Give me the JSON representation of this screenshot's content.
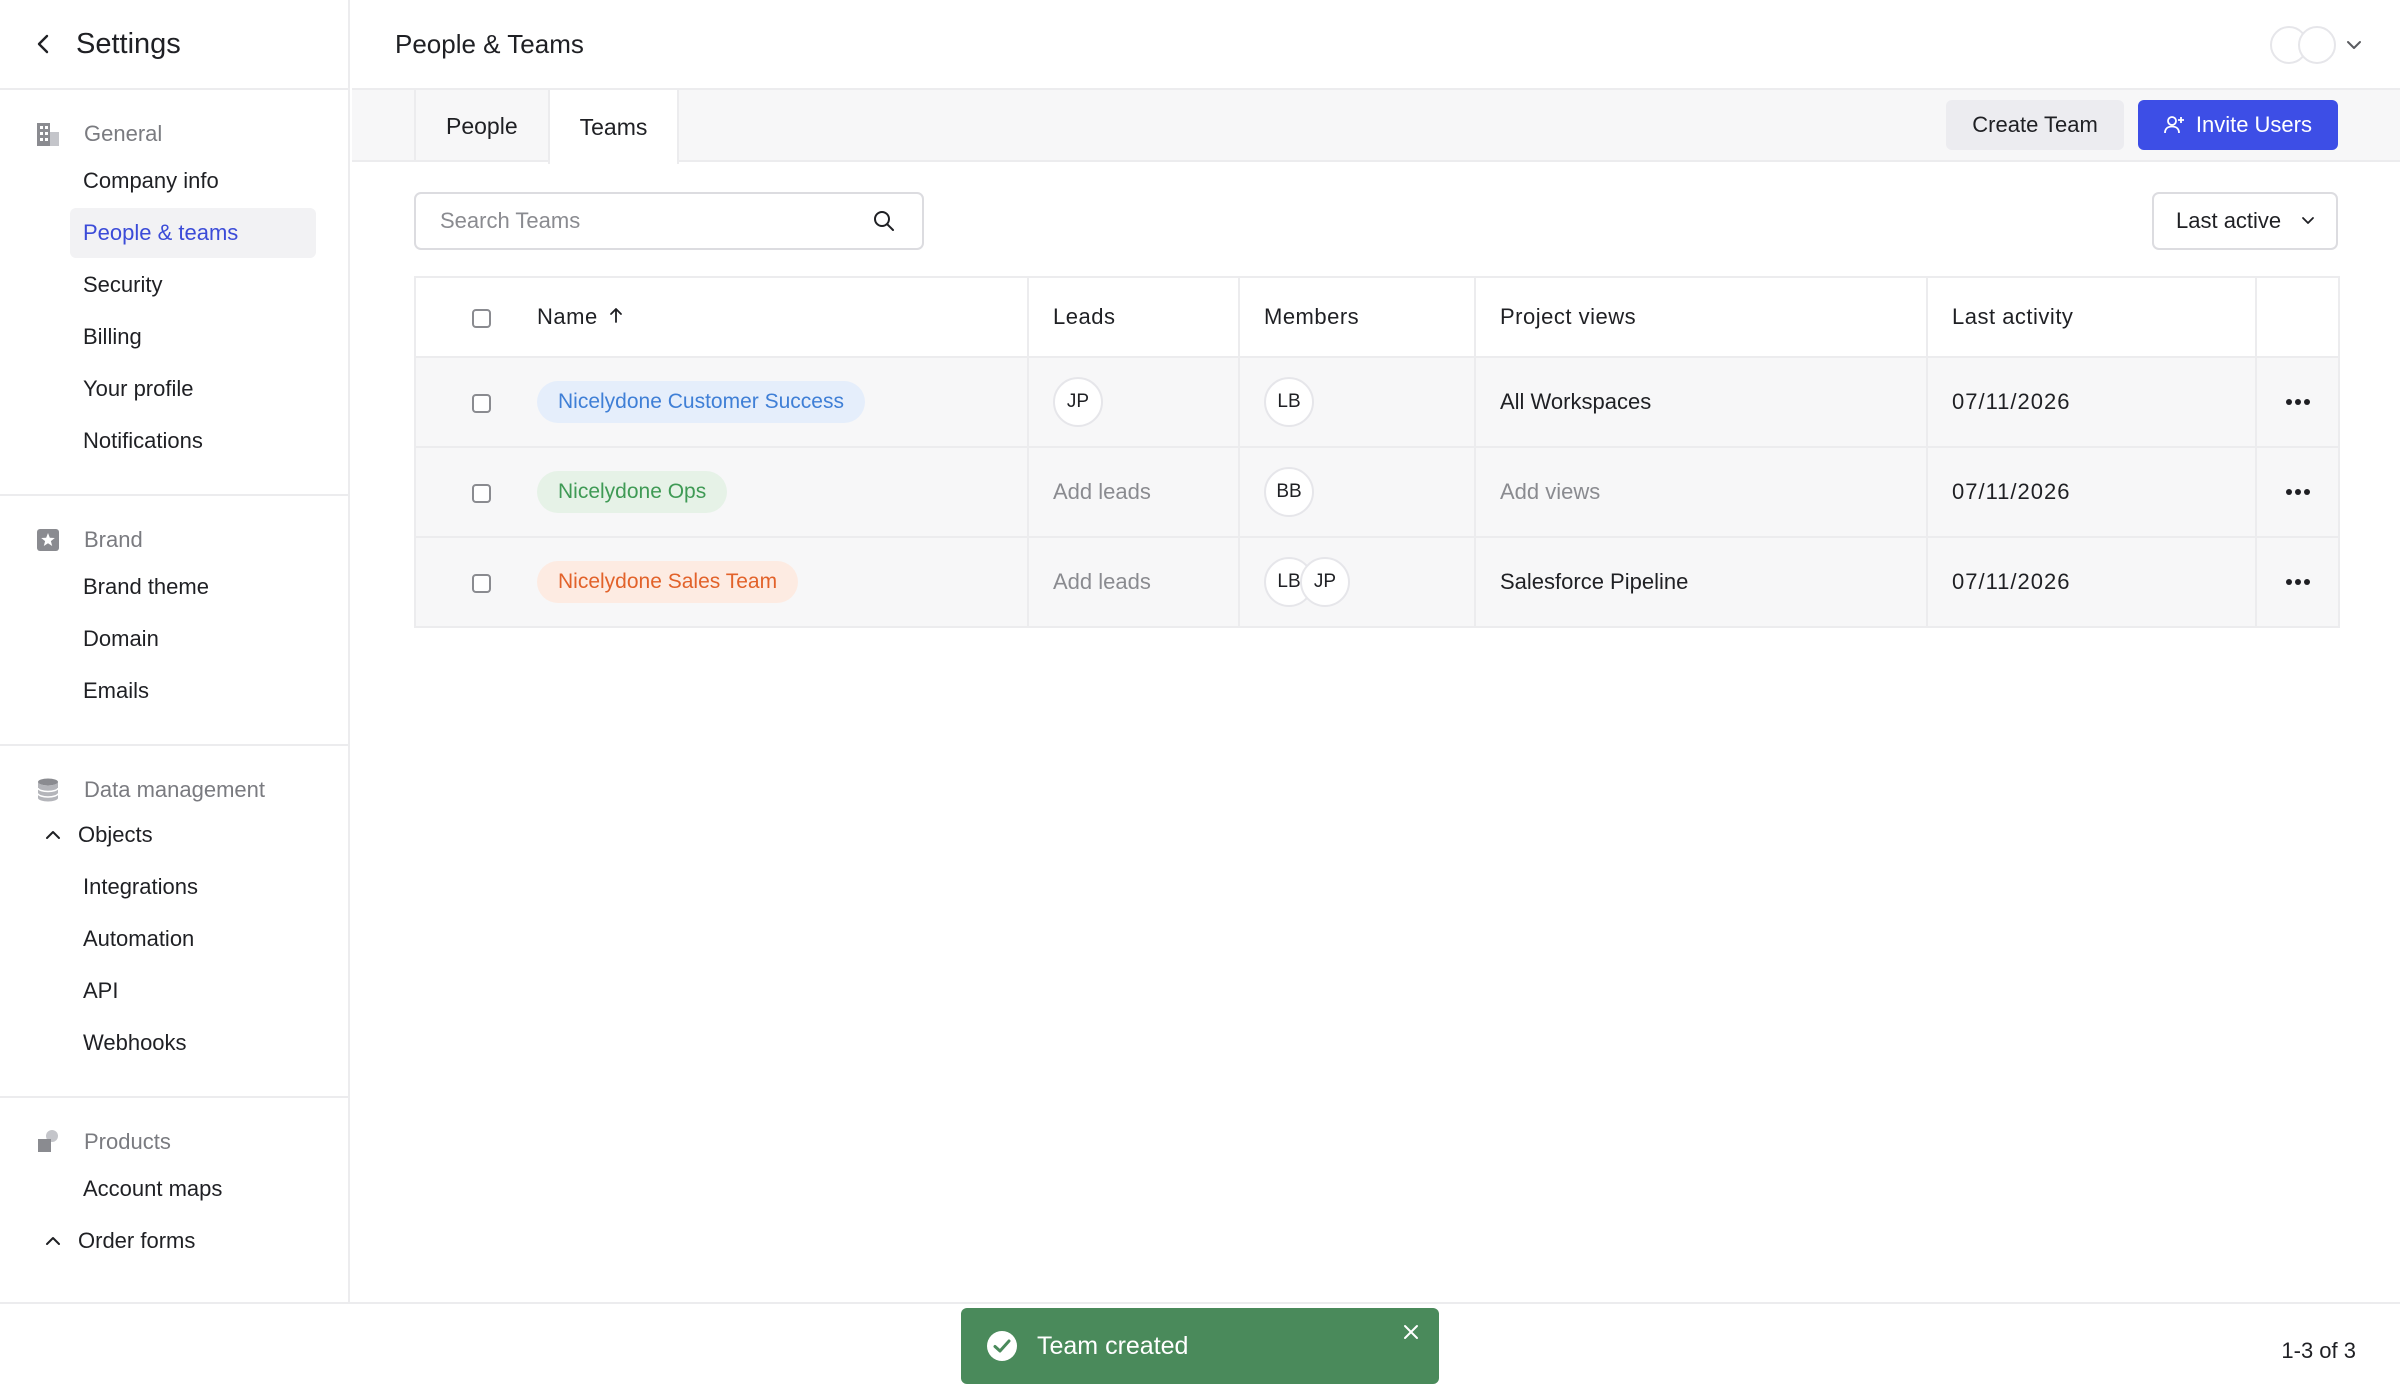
{
  "sidebar": {
    "title": "Settings",
    "back_icon": "chevron-left-icon",
    "sections": {
      "general": {
        "label": "General",
        "icon": "building-icon",
        "items": [
          "Company info",
          "People & teams",
          "Security",
          "Billing",
          "Your profile",
          "Notifications"
        ],
        "active": "People & teams"
      },
      "brand": {
        "label": "Brand",
        "icon": "star-badge-icon",
        "items": [
          "Brand theme",
          "Domain",
          "Emails"
        ]
      },
      "data": {
        "label": "Data management",
        "icon": "database-icon",
        "objects_label": "Objects",
        "items": [
          "Integrations",
          "Automation",
          "API",
          "Webhooks"
        ]
      },
      "products": {
        "label": "Products",
        "icon": "cube-icon",
        "items": [
          "Account maps"
        ],
        "order_forms_label": "Order forms"
      }
    }
  },
  "header": {
    "title": "People & Teams"
  },
  "tabs": {
    "people": "People",
    "teams": "Teams",
    "active": "Teams"
  },
  "actions": {
    "create_team": "Create Team",
    "invite_users": "Invite Users"
  },
  "search": {
    "placeholder": "Search Teams",
    "value": ""
  },
  "sort": {
    "selected": "Last active"
  },
  "table": {
    "columns": {
      "name": "Name",
      "leads": "Leads",
      "members": "Members",
      "project_views": "Project views",
      "last_activity": "Last activity"
    },
    "sort_direction": "ascending",
    "rows": [
      {
        "name": "Nicelydone Customer Success",
        "pill_bg": "#e5eefb",
        "pill_fg": "#3f7fd6",
        "leads": [
          "JP"
        ],
        "leads_empty": "",
        "members": [
          "LB"
        ],
        "project_views": "All Workspaces",
        "project_views_empty": "",
        "last_activity": "07/11/2026"
      },
      {
        "name": "Nicelydone Ops",
        "pill_bg": "#e6f2e7",
        "pill_fg": "#3f9a55",
        "leads": [],
        "leads_empty": "Add leads",
        "members": [
          "BB"
        ],
        "project_views": "",
        "project_views_empty": "Add views",
        "last_activity": "07/11/2026"
      },
      {
        "name": "Nicelydone Sales Team",
        "pill_bg": "#fdebe2",
        "pill_fg": "#e2622a",
        "leads": [],
        "leads_empty": "Add leads",
        "members": [
          "LB",
          "JP"
        ],
        "project_views": "Salesforce Pipeline",
        "project_views_empty": "",
        "last_activity": "07/11/2026"
      }
    ]
  },
  "footer": {
    "pagination": "1-3 of 3"
  },
  "toast": {
    "message": "Team created",
    "color": "#4a8a5b"
  }
}
